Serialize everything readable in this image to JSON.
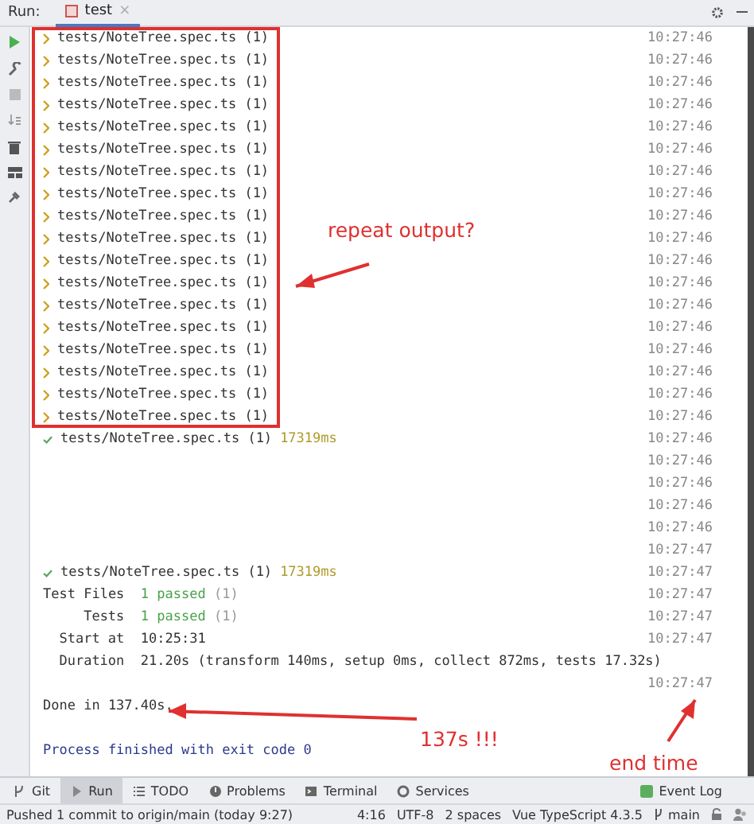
{
  "run_panel": {
    "label": "Run:",
    "tabs": [
      {
        "title": "test",
        "selected": true,
        "close": "×"
      }
    ]
  },
  "lines": [
    {
      "kind": "running",
      "text": "tests/NoteTree.spec.ts (1)",
      "time": "10:27:46"
    },
    {
      "kind": "running",
      "text": "tests/NoteTree.spec.ts (1)",
      "time": "10:27:46"
    },
    {
      "kind": "running",
      "text": "tests/NoteTree.spec.ts (1)",
      "time": "10:27:46"
    },
    {
      "kind": "running",
      "text": "tests/NoteTree.spec.ts (1)",
      "time": "10:27:46"
    },
    {
      "kind": "running",
      "text": "tests/NoteTree.spec.ts (1)",
      "time": "10:27:46"
    },
    {
      "kind": "running",
      "text": "tests/NoteTree.spec.ts (1)",
      "time": "10:27:46"
    },
    {
      "kind": "running",
      "text": "tests/NoteTree.spec.ts (1)",
      "time": "10:27:46"
    },
    {
      "kind": "running",
      "text": "tests/NoteTree.spec.ts (1)",
      "time": "10:27:46"
    },
    {
      "kind": "running",
      "text": "tests/NoteTree.spec.ts (1)",
      "time": "10:27:46"
    },
    {
      "kind": "running",
      "text": "tests/NoteTree.spec.ts (1)",
      "time": "10:27:46"
    },
    {
      "kind": "running",
      "text": "tests/NoteTree.spec.ts (1)",
      "time": "10:27:46"
    },
    {
      "kind": "running",
      "text": "tests/NoteTree.spec.ts (1)",
      "time": "10:27:46"
    },
    {
      "kind": "running",
      "text": "tests/NoteTree.spec.ts (1)",
      "time": "10:27:46"
    },
    {
      "kind": "running",
      "text": "tests/NoteTree.spec.ts (1)",
      "time": "10:27:46"
    },
    {
      "kind": "running",
      "text": "tests/NoteTree.spec.ts (1)",
      "time": "10:27:46"
    },
    {
      "kind": "running",
      "text": "tests/NoteTree.spec.ts (1)",
      "time": "10:27:46"
    },
    {
      "kind": "running",
      "text": "tests/NoteTree.spec.ts (1)",
      "time": "10:27:46"
    },
    {
      "kind": "running",
      "text": "tests/NoteTree.spec.ts (1)",
      "time": "10:27:46"
    },
    {
      "kind": "passed",
      "text": "tests/NoteTree.spec.ts (1)",
      "duration": "17319ms",
      "time": "10:27:46"
    },
    {
      "kind": "blank",
      "time": "10:27:46"
    },
    {
      "kind": "blank",
      "time": "10:27:46"
    },
    {
      "kind": "blank",
      "time": "10:27:46"
    },
    {
      "kind": "blank",
      "time": "10:27:46"
    },
    {
      "kind": "blank",
      "time": "10:27:47"
    },
    {
      "kind": "passed",
      "text": "tests/NoteTree.spec.ts (1)",
      "duration": "17319ms",
      "time": "10:27:47"
    },
    {
      "kind": "summary",
      "label": "Test Files",
      "value": "1 passed",
      "extra": "(1)",
      "time": "10:27:47"
    },
    {
      "kind": "summary",
      "label": "Tests",
      "value": "1 passed",
      "extra": "(1)",
      "time": "10:27:47"
    },
    {
      "kind": "field",
      "label": "Start at",
      "value": "10:25:31",
      "time": "10:27:47"
    },
    {
      "kind": "field",
      "label": "Duration",
      "value": "21.20s (transform 140ms, setup 0ms, collect 872ms, tests 17.32s)"
    },
    {
      "kind": "blank",
      "time": "10:27:47"
    },
    {
      "kind": "plain",
      "text": "Done in 137.40s."
    },
    {
      "kind": "blank"
    },
    {
      "kind": "exit",
      "text": "Process finished with exit code 0"
    }
  ],
  "annotations": [
    {
      "kind": "box"
    },
    {
      "kind": "note",
      "text": "repeat output?"
    },
    {
      "kind": "note",
      "text": "137s !!!"
    },
    {
      "kind": "note",
      "text": "end time"
    }
  ],
  "tool_tabs": [
    {
      "label": "Git",
      "selected": false
    },
    {
      "label": "Run",
      "selected": true
    },
    {
      "label": "TODO",
      "selected": false
    },
    {
      "label": "Problems",
      "selected": false
    },
    {
      "label": "Terminal",
      "selected": false
    },
    {
      "label": "Services",
      "selected": false
    }
  ],
  "event_log": "Event Log",
  "status_bar": {
    "message": "Pushed 1 commit to origin/main (today 9:27)",
    "items": [
      "4:16",
      "UTF-8",
      "2 spaces",
      "Vue TypeScript 4.3.5",
      "main"
    ]
  }
}
